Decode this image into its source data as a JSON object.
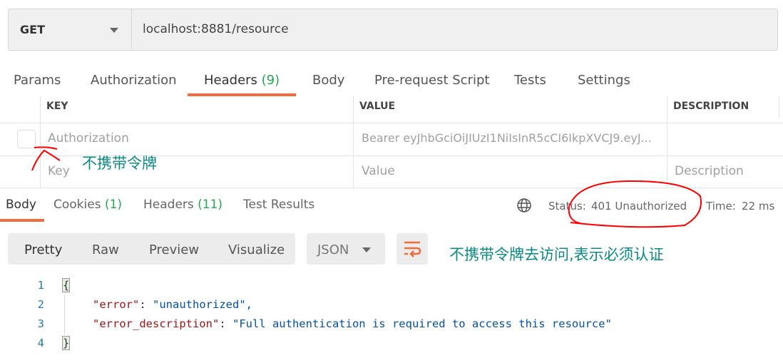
{
  "request": {
    "method": "GET",
    "url": "localhost:8881/resource"
  },
  "request_tabs": [
    {
      "label": "Params"
    },
    {
      "label": "Authorization"
    },
    {
      "label": "Headers",
      "count": "(9)"
    },
    {
      "label": "Body"
    },
    {
      "label": "Pre-request Script"
    },
    {
      "label": "Tests"
    },
    {
      "label": "Settings"
    }
  ],
  "headers_table": {
    "columns": [
      "KEY",
      "VALUE",
      "DESCRIPTION"
    ],
    "rows": [
      {
        "key": "Authorization",
        "value": "Bearer eyJhbGciOiJIUzI1NiIsInR5cCI6IkpXVCJ9.eyJ...",
        "description": "",
        "checked": false
      }
    ],
    "placeholder": {
      "key": "Key",
      "value": "Value",
      "description": "Description"
    }
  },
  "response_tabs": [
    {
      "label": "Body"
    },
    {
      "label": "Cookies",
      "count": "(1)"
    },
    {
      "label": "Headers",
      "count": "(11)"
    },
    {
      "label": "Test Results"
    }
  ],
  "status": {
    "label": "Status:",
    "value": "401 Unauthorized",
    "time_label": "Time:",
    "time_value": "22 ms"
  },
  "view_modes": [
    "Pretty",
    "Raw",
    "Preview",
    "Visualize"
  ],
  "format": "JSON",
  "code_lines": [
    {
      "n": "1",
      "text": "{"
    },
    {
      "n": "2",
      "key": "\"error\"",
      "value": "\"unauthorized\","
    },
    {
      "n": "3",
      "key": "\"error_description\"",
      "value": "\"Full authentication is required to access this resource\""
    },
    {
      "n": "4",
      "text": "}"
    }
  ],
  "annotations": {
    "no_token": "不携带令牌",
    "no_token_access": "不携带令牌去访问,表示必须认证"
  },
  "colors": {
    "accent": "#f26b3a",
    "success": "#26a650",
    "annotation_red": "#ff0000",
    "annotation_teal": "#0b8a85"
  }
}
